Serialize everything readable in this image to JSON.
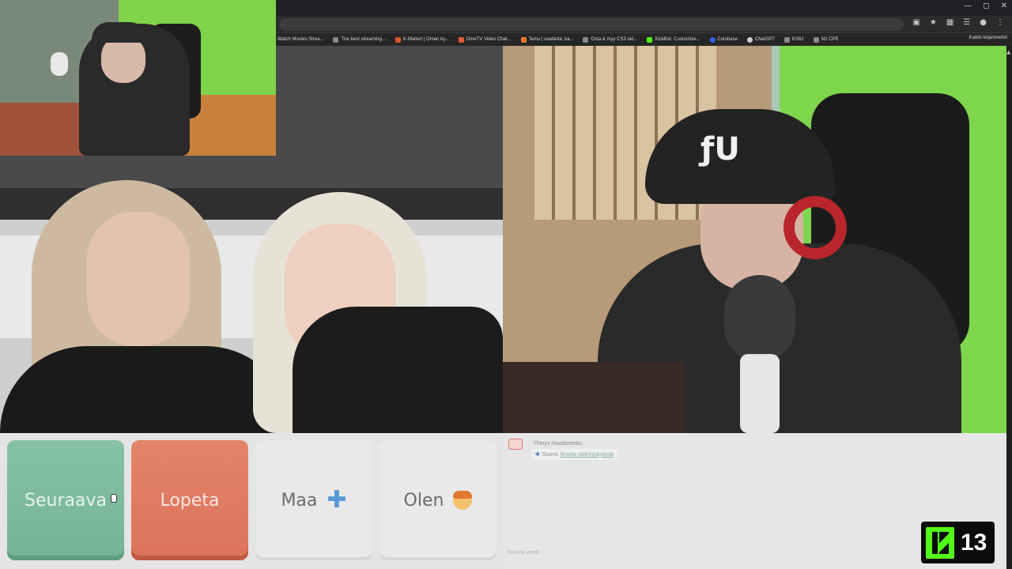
{
  "browser": {
    "bookmarks": [
      "Watch Movies Strea...",
      "The best streaming...",
      "K-Market | Oman ky...",
      "OmeTV Video Chat...",
      "Temu | vaatteita, ka...",
      "Osta & myy CS2-skI...",
      "KickBot: Customize...",
      "Coinbase",
      "ChatGPT",
      "KS62",
      "5G CPE"
    ],
    "bookmarks_folder": "Kaikki kirjanmerkit"
  },
  "controls": {
    "next_label": "Seuraava",
    "stop_label": "Lopeta",
    "country_label": "Maa",
    "gender_label": "Olen"
  },
  "chat": {
    "status": "Yhteys muodostettu.",
    "country": "Suomi",
    "report_link": "ilmoita väärinkäytöstä",
    "input_placeholder": "Kirjoita viesti"
  },
  "overlay": {
    "badge_number": "13"
  },
  "colors": {
    "next": "#7bb99a",
    "stop": "#de7a60",
    "kick": "#53fc18"
  }
}
